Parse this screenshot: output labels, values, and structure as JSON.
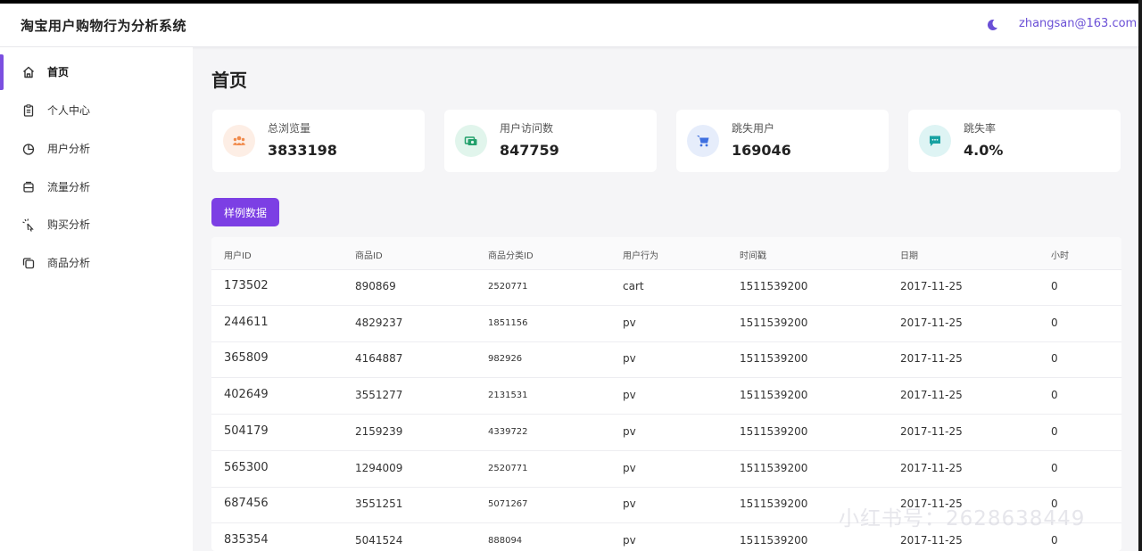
{
  "header": {
    "title": "淘宝用户购物行为分析系统",
    "user_email": "zhangsan@163.com",
    "theme_icon": "moon-icon"
  },
  "sidebar": {
    "items": [
      {
        "label": "首页",
        "icon": "home-icon",
        "active": true
      },
      {
        "label": "个人中心",
        "icon": "clipboard-icon",
        "active": false
      },
      {
        "label": "用户分析",
        "icon": "pie-chart-icon",
        "active": false
      },
      {
        "label": "流量分析",
        "icon": "layers-icon",
        "active": false
      },
      {
        "label": "购买分析",
        "icon": "cursor-click-icon",
        "active": false
      },
      {
        "label": "商品分析",
        "icon": "copy-icon",
        "active": false
      }
    ]
  },
  "main": {
    "page_title": "首页",
    "stats": [
      {
        "label": "总浏览量",
        "value": "3833198",
        "icon": "users-icon",
        "color": "#f08a4b",
        "bg": "#fdeee5"
      },
      {
        "label": "用户访问数",
        "value": "847759",
        "icon": "money-icon",
        "color": "#22a06b",
        "bg": "#e1f5ec"
      },
      {
        "label": "跳失用户",
        "value": "169046",
        "icon": "cart-icon",
        "color": "#3d6fe0",
        "bg": "#e6edfb"
      },
      {
        "label": "跳失率",
        "value": "4.0%",
        "icon": "message-icon",
        "color": "#17a2a2",
        "bg": "#def4f4"
      }
    ],
    "sample_button": "样例数据",
    "table": {
      "headers": [
        "用户ID",
        "商品ID",
        "商品分类ID",
        "用户行为",
        "时间戳",
        "日期",
        "小时"
      ],
      "rows": [
        [
          "173502",
          "890869",
          "2520771",
          "cart",
          "1511539200",
          "2017-11-25",
          "0"
        ],
        [
          "244611",
          "4829237",
          "1851156",
          "pv",
          "1511539200",
          "2017-11-25",
          "0"
        ],
        [
          "365809",
          "4164887",
          "982926",
          "pv",
          "1511539200",
          "2017-11-25",
          "0"
        ],
        [
          "402649",
          "3551277",
          "2131531",
          "pv",
          "1511539200",
          "2017-11-25",
          "0"
        ],
        [
          "504179",
          "2159239",
          "4339722",
          "pv",
          "1511539200",
          "2017-11-25",
          "0"
        ],
        [
          "565300",
          "1294009",
          "2520771",
          "pv",
          "1511539200",
          "2017-11-25",
          "0"
        ],
        [
          "687456",
          "3551251",
          "5071267",
          "pv",
          "1511539200",
          "2017-11-25",
          "0"
        ],
        [
          "835354",
          "5041524",
          "888094",
          "pv",
          "1511539200",
          "2017-11-25",
          "0"
        ]
      ]
    }
  },
  "watermark": "小红书号：2628638449"
}
